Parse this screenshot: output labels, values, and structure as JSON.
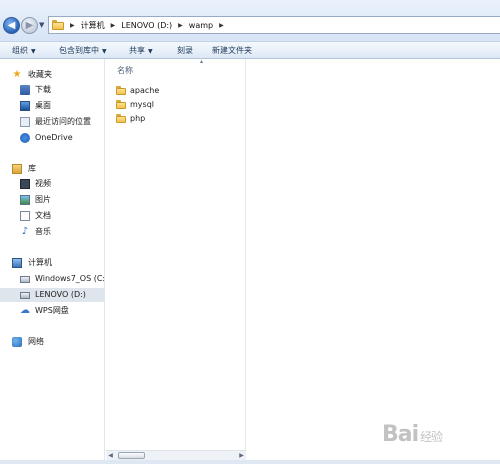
{
  "address": {
    "crumbs": [
      "计算机",
      "LENOVO (D:)",
      "wamp"
    ]
  },
  "toolbar": {
    "organize": "组织",
    "include_in_library": "包含到库中",
    "share": "共享",
    "burn": "刻录",
    "new_folder": "新建文件夹"
  },
  "nav": {
    "favorites": "收藏夹",
    "downloads": "下载",
    "desktop": "桌面",
    "recent": "最近访问的位置",
    "onedrive": "OneDrive",
    "libraries": "库",
    "videos": "视频",
    "pictures": "图片",
    "documents": "文档",
    "music": "音乐",
    "computer": "计算机",
    "windows_os": "Windows7_OS (C:",
    "lenovo_d": "LENOVO (D:)",
    "wps": "WPS网盘",
    "network": "网络"
  },
  "content": {
    "column_name": "名称",
    "files": [
      "apache",
      "mysql",
      "php"
    ]
  },
  "watermark": {
    "text": "Bai",
    "suffix": "经验"
  }
}
